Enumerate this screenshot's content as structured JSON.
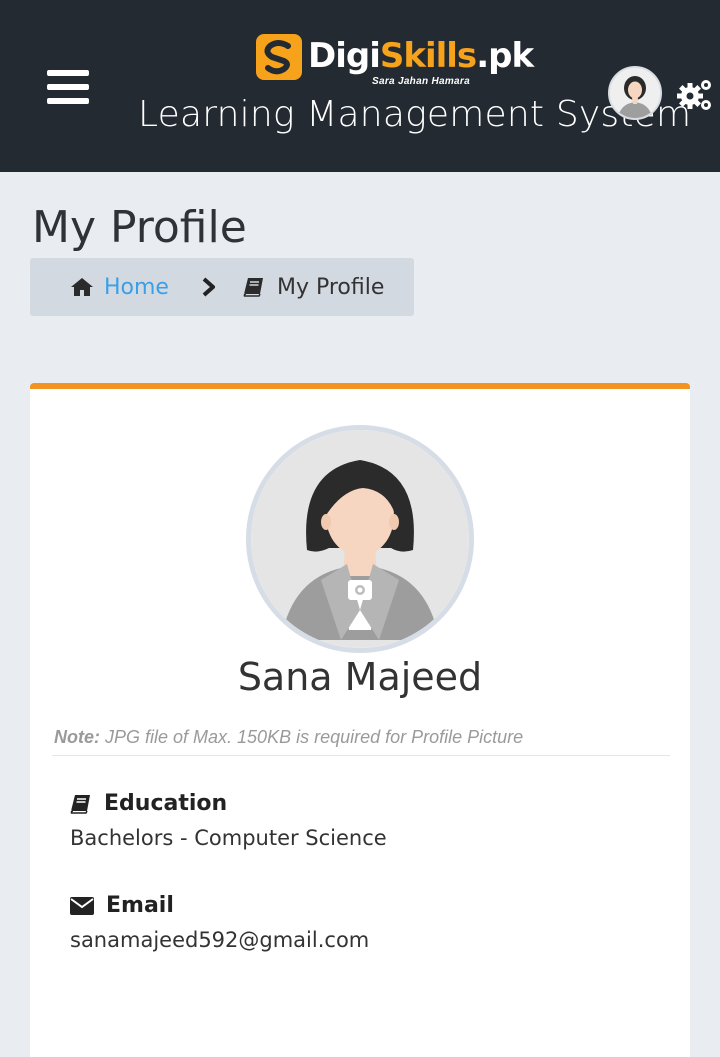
{
  "header": {
    "logo_word_white": "Digi",
    "logo_word_orange": "Skills",
    "logo_suffix": ".pk",
    "logo_tagline": "Sara Jahan Hamara",
    "subtitle": "Learning Management System",
    "menu_icon": "hamburger-menu-icon",
    "avatar_icon": "user-avatar",
    "settings_icon": "gears-icon"
  },
  "page": {
    "title": "My Profile"
  },
  "breadcrumb": {
    "home": "Home",
    "current": "My Profile"
  },
  "profile": {
    "name": "Sana Majeed",
    "note_label": "Note:",
    "note_text": " JPG file of Max. 150KB is required for Profile Picture",
    "education_label": "Education",
    "education_value": "Bachelors - Computer Science",
    "email_label": "Email",
    "email_value": "sanamajeed592@gmail.com"
  },
  "colors": {
    "header_bg": "#232a31",
    "accent_orange": "#f39322",
    "link_blue": "#3aa0e6",
    "page_bg": "#e9edf2"
  }
}
